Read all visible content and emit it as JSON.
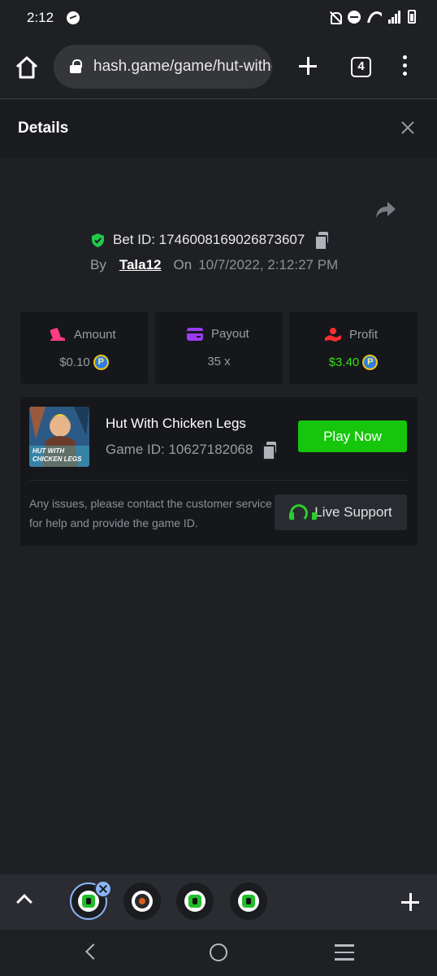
{
  "status_bar": {
    "time": "2:12"
  },
  "browser": {
    "url": "hash.game/game/hut-with-chicken-legs",
    "tab_count": "4"
  },
  "details": {
    "title": "Details",
    "bet_id": "Bet ID: 1746008169026873607",
    "by_label": "By",
    "username": "Tala12",
    "on_label": "On",
    "datetime": "10/7/2022, 2:12:27 PM"
  },
  "stats": [
    {
      "label": "Amount",
      "value": "$0.10"
    },
    {
      "label": "Payout",
      "value": "35 x"
    },
    {
      "label": "Profit",
      "value": "$3.40"
    }
  ],
  "game": {
    "title": "Hut With Chicken Legs",
    "game_id": "Game ID: 10627182068",
    "thumb_text_1": "HUT WITH",
    "thumb_text_2": "CHICKEN LEGS",
    "play_label": "Play Now",
    "help_text": "Any issues, please contact the customer service for help and provide the game ID.",
    "support_label": "Live Support"
  },
  "colors": {
    "accent_green": "#16c60c",
    "profit_green": "#3bdd1a",
    "background": "#1f2023",
    "card": "#16171a"
  }
}
